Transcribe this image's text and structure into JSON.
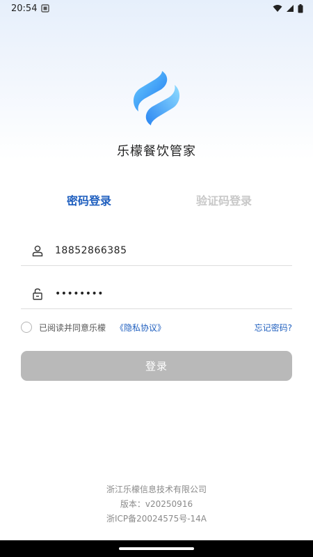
{
  "status_bar": {
    "time": "20:54"
  },
  "app": {
    "name": "乐檬餐饮管家"
  },
  "tabs": {
    "password_login": "密码登录",
    "code_login": "验证码登录"
  },
  "form": {
    "phone_value": "18852866385",
    "password_value": "••••••••"
  },
  "agreement": {
    "prefix": "已阅读并同意乐檬",
    "privacy_link": "《隐私协议》",
    "forgot_password": "忘记密码?"
  },
  "login_button": {
    "label": "登录"
  },
  "footer": {
    "company": "浙江乐檬信息技术有限公司",
    "version": "版本：v20250916",
    "icp": "浙ICP备20024575号-14A"
  },
  "colors": {
    "accent": "#1f5fbf",
    "disabled_button": "#b9b9b9"
  }
}
